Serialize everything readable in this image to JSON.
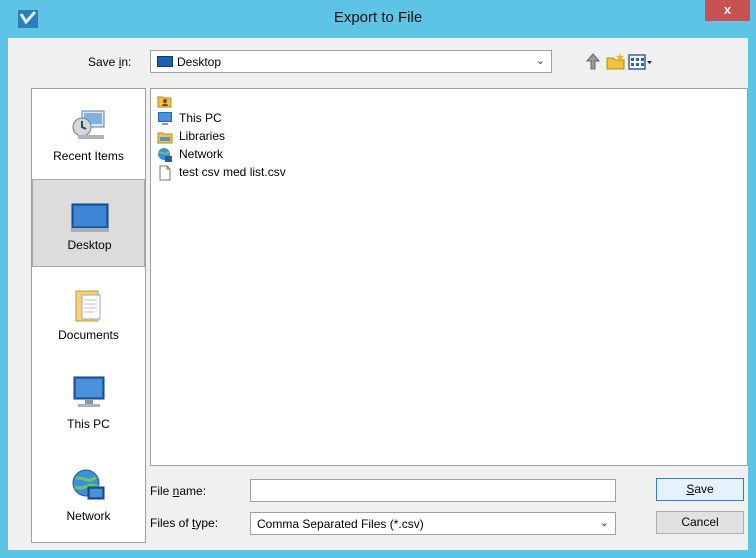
{
  "window": {
    "title": "Export to File",
    "close_label": "x"
  },
  "save_in": {
    "label_prefix": "Save ",
    "label_accel": "i",
    "label_suffix": "n:",
    "value": "Desktop"
  },
  "toolbar": {
    "icons": [
      "up-one-level-icon",
      "create-new-folder-icon",
      "view-menu-icon"
    ]
  },
  "places": [
    {
      "label": "Recent Items",
      "icon": "recent-items-icon",
      "selected": false
    },
    {
      "label": "Desktop",
      "icon": "desktop-icon",
      "selected": true
    },
    {
      "label": "Documents",
      "icon": "documents-icon",
      "selected": false
    },
    {
      "label": "This PC",
      "icon": "this-pc-icon",
      "selected": false
    },
    {
      "label": "Network",
      "icon": "network-icon",
      "selected": false
    }
  ],
  "files": [
    {
      "name": "",
      "icon": "user-folder-icon"
    },
    {
      "name": "This PC",
      "icon": "this-pc-icon"
    },
    {
      "name": "Libraries",
      "icon": "libraries-icon"
    },
    {
      "name": "Network",
      "icon": "network-icon"
    },
    {
      "name": "test csv med list.csv",
      "icon": "file-icon"
    }
  ],
  "file_name": {
    "label_prefix": "File ",
    "label_accel": "n",
    "label_suffix": "ame:",
    "value": ""
  },
  "file_type": {
    "label_prefix": "Files of ",
    "label_accel": "t",
    "label_suffix": "ype:",
    "value": "Comma Separated Files (*.csv)"
  },
  "buttons": {
    "save_accel": "S",
    "save_rest": "ave",
    "cancel": "Cancel"
  },
  "colors": {
    "titlebar": "#5ec4e6",
    "close": "#c75050",
    "selection": "#dcdcdc"
  }
}
